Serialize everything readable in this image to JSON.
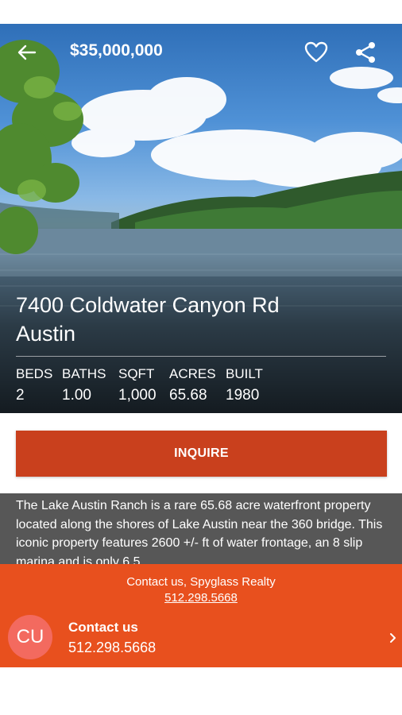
{
  "header": {
    "price": "$35,000,000",
    "icons": {
      "back": "arrow-left-icon",
      "favorite": "heart-outline-icon",
      "share": "share-icon"
    }
  },
  "property": {
    "address_line1": "7400 Coldwater Canyon Rd",
    "address_line2": "Austin",
    "stats": [
      {
        "label": "BEDS",
        "value": "2"
      },
      {
        "label": "BATHS",
        "value": "1.00"
      },
      {
        "label": "SQFT",
        "value": "1,000"
      },
      {
        "label": "ACRES",
        "value": "65.68"
      },
      {
        "label": "BUILT",
        "value": "1980"
      }
    ]
  },
  "inquire_label": "INQUIRE",
  "description": "The Lake Austin Ranch is a rare 65.68 acre waterfront property located along the shores of Lake Austin near the 360 bridge. This iconic property features 2600 +/- ft of water frontage, an 8 slip marina and is only 6.5",
  "contact": {
    "heading": "Contact us, Spyglass Realty",
    "phone_link": "512.298.5668",
    "avatar_initials": "CU",
    "title": "Contact us",
    "phone": "512.298.5668",
    "chevron_icon": "chevron-right-icon"
  },
  "colors": {
    "accent_button": "#c9401d",
    "contact_panel": "#e8501e",
    "avatar": "#f36a5f",
    "description_bg": "#575757"
  }
}
